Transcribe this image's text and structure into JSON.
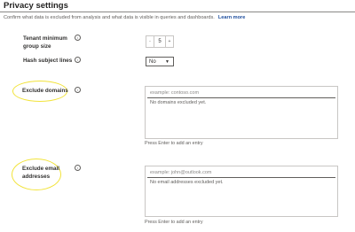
{
  "page": {
    "title": "Privacy settings",
    "description": "Confirm what data is excluded from analysis and what data is visible in queries and dashboards.",
    "learn_more": "Learn more"
  },
  "tenant_min_group": {
    "label_line1": "Tenant minimum",
    "label_line2": "group size",
    "value": "5",
    "decrement": "-",
    "increment": "+"
  },
  "hash_subject": {
    "label": "Hash subject lines",
    "selected": "No"
  },
  "exclude_domains": {
    "label": "Exclude domains",
    "placeholder": "example: contoso.com",
    "empty_text": "No domains excluded yet.",
    "hint": "Press Enter to add an entry"
  },
  "exclude_emails": {
    "label_line1": "Exclude email",
    "label_line2": "addresses",
    "placeholder": "example: john@outlook.com",
    "empty_text": "No email addresses excluded yet.",
    "hint": "Press Enter to add an entry"
  },
  "icons": {
    "info": "info-icon",
    "chevron": "chevron-down-icon"
  },
  "colors": {
    "link": "#1e4e9d",
    "highlight": "#f2e33a"
  }
}
